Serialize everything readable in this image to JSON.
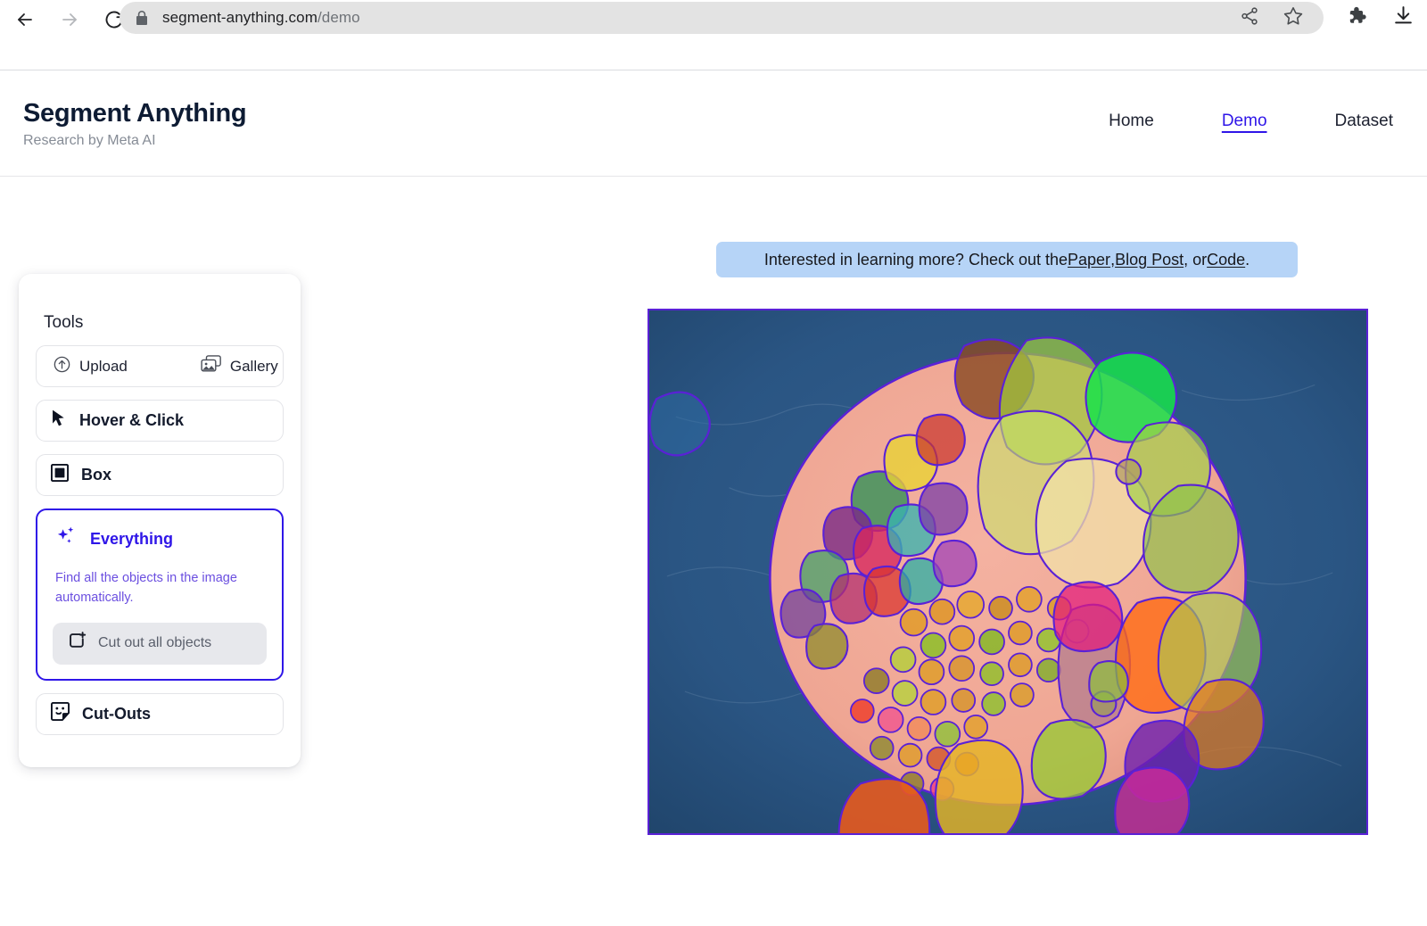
{
  "browser": {
    "back_icon": "arrow-left-icon",
    "forward_icon": "arrow-right-icon",
    "reload_icon": "reload-icon",
    "lock_icon": "lock-icon",
    "url_domain": "segment-anything.com",
    "url_path": "/demo",
    "url_full": "segment-anything.com/demo",
    "share_icon": "share-icon",
    "bookmark_icon": "star-icon",
    "extensions_icon": "puzzle-piece-icon",
    "downloads_icon": "download-icon"
  },
  "header": {
    "title": "Segment Anything",
    "subtitle": "Research by Meta AI",
    "nav": [
      {
        "label": "Home",
        "active": false
      },
      {
        "label": "Demo",
        "active": true
      },
      {
        "label": "Dataset",
        "active": false
      }
    ]
  },
  "tools": {
    "title": "Tools",
    "upload_label": "Upload",
    "upload_icon": "upload-circle-icon",
    "gallery_label": "Gallery",
    "gallery_icon": "gallery-images-icon",
    "hover_click_label": "Hover & Click",
    "hover_click_icon": "cursor-arrow-icon",
    "box_label": "Box",
    "box_icon": "box-select-icon",
    "everything": {
      "label": "Everything",
      "icon": "sparkles-icon",
      "description": "Find all the objects in the image automatically.",
      "cut_out_label": "Cut out all objects",
      "cut_out_icon": "cut-out-plus-icon",
      "selected": true,
      "accent_color": "#2f16e8",
      "description_color": "#6b4fe0"
    },
    "cutouts_label": "Cut-Outs",
    "cutouts_icon": "sticker-face-icon"
  },
  "banner": {
    "prefix": "Interested in learning more? Check out the ",
    "link_paper": "Paper",
    "sep1": ", ",
    "link_blog": "Blog Post",
    "sep2": ", or ",
    "link_code": "Code",
    "suffix": ".",
    "background_color": "#b6d4f7"
  },
  "image_panel": {
    "alt": "salad plate with segmentation masks",
    "border_color": "#5a21d6",
    "background_color": "#2a5583",
    "plate_color": "#f0a894",
    "mask_outline_color": "#5a21d6"
  }
}
